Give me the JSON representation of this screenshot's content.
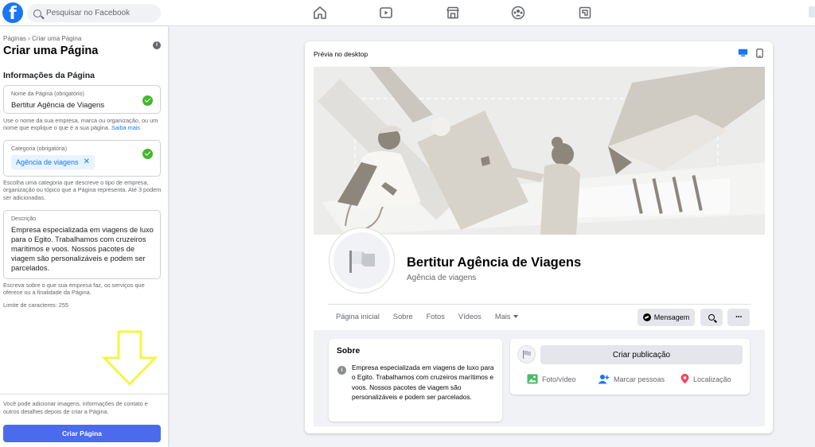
{
  "topbar": {
    "logo_letter": "f",
    "search_placeholder": "Pesquisar no Facebook",
    "nav_icons": [
      "home-icon",
      "watch-icon",
      "marketplace-icon",
      "groups-icon",
      "gaming-icon"
    ]
  },
  "left_panel": {
    "breadcrumb": "Páginas › Criar uma Página",
    "title": "Criar uma Página",
    "section_title": "Informações da Página",
    "name_field": {
      "label": "Nome da Página (obrigatório)",
      "value": "Bertitur Agência de Viagens"
    },
    "name_help": "Use o nome da sua empresa, marca ou organização, ou um nome que explique o que é a sua página.",
    "name_help_link": "Saiba mais",
    "category_field": {
      "label": "Categoria (obrigatória)",
      "chip": "Agência de viagens",
      "chip_remove": "✕"
    },
    "category_help": "Escolha uma categoria que descreve o tipo de empresa, organização ou tópico que a Página representa. Até 3 podem ser adicionadas.",
    "description_field": {
      "label": "Descrição",
      "value": "Empresa especializada em viagens de luxo para o Egito. Trabalhamos com cruzeiros marítimos e voos. Nossos pacotes de viagem são personalizáveis e podem ser parcelados."
    },
    "description_help": "Escreva sobre o que sua empresa faz, os serviços que oferece ou a finalidade da Página.",
    "char_limit": "Limite de caracteres: 255",
    "bottom_note": "Você pode adicionar imagens, informações de contato e outros detalhes depois de criar a Página.",
    "create_button": "Criar Página",
    "accent_color": "#4b6bec",
    "arrow_color": "#f5f542"
  },
  "preview": {
    "title": "Prévia no desktop",
    "page_name": "Bertitur Agência de Viagens",
    "page_category": "Agência de viagens",
    "tabs": [
      "Página inicial",
      "Sobre",
      "Fotos",
      "Vídeos",
      "Mais"
    ],
    "message_button": "Mensagem",
    "about": {
      "title": "Sobre",
      "text": "Empresa especializada em viagens de luxo para o Egito. Trabalhamos com cruzeiros marítimos e voos. Nossos pacotes de viagem são personalizáveis e podem ser parcelados."
    },
    "post": {
      "create_button": "Criar publicação",
      "photo_video": "Foto/vídeo",
      "tag_people": "Marcar pessoas",
      "location": "Localização"
    }
  }
}
